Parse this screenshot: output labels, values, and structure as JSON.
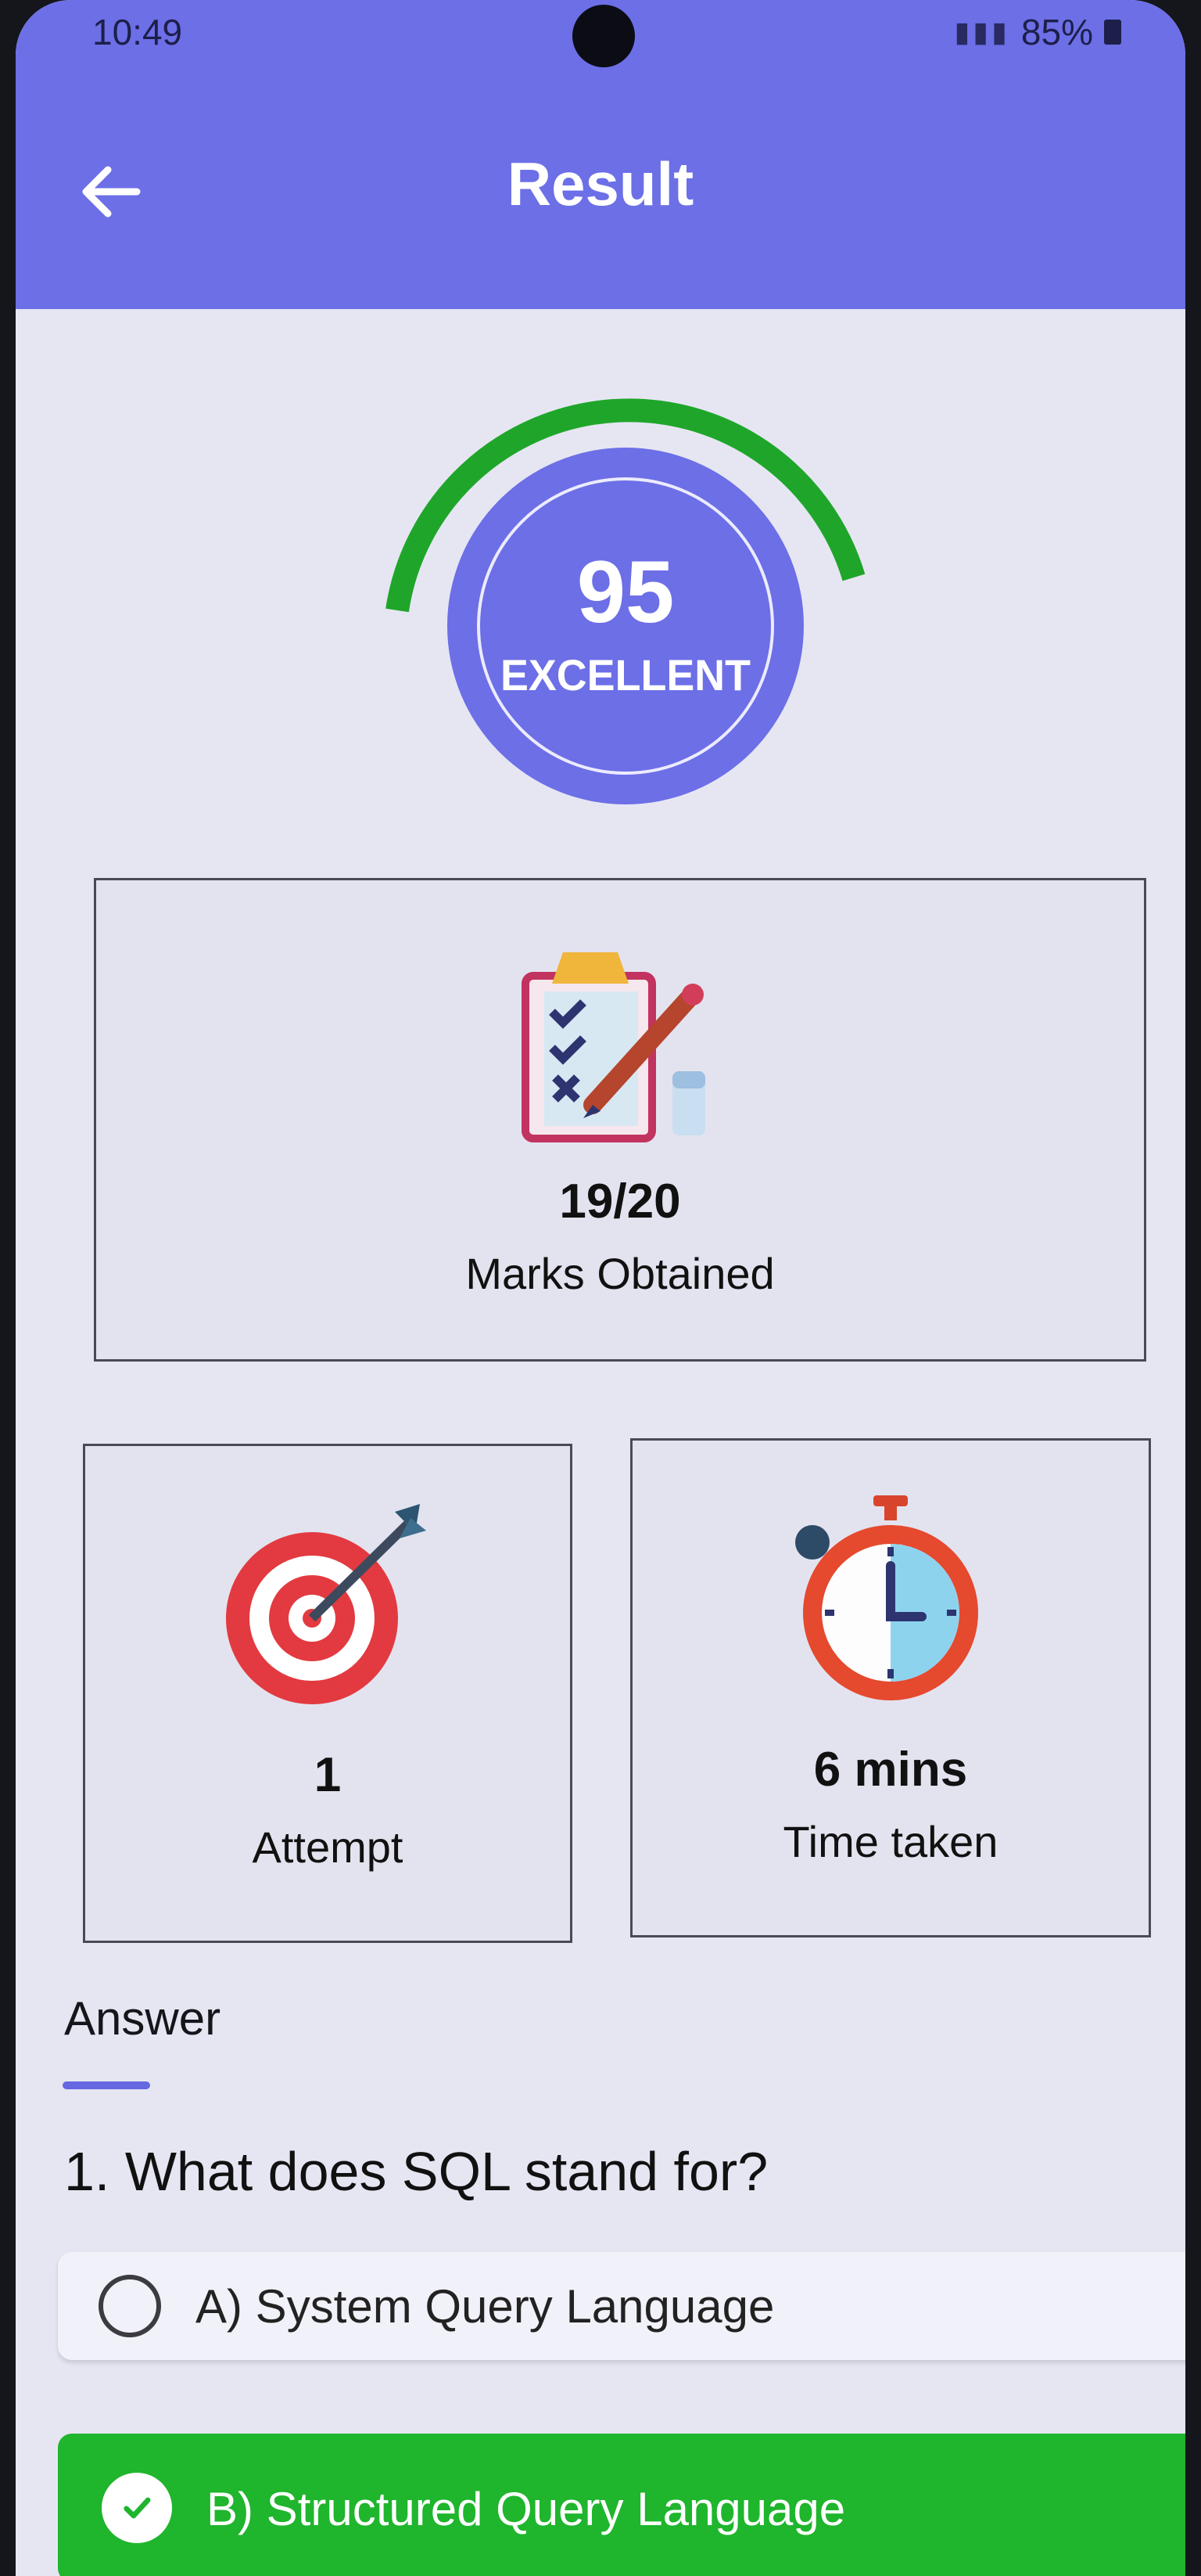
{
  "status_bar": {
    "time": "10:49",
    "battery": "85%"
  },
  "header": {
    "title": "Result"
  },
  "score": {
    "value": "95",
    "grade": "EXCELLENT",
    "progress_percent": 95
  },
  "marks_card": {
    "value": "19/20",
    "label": "Marks Obtained"
  },
  "attempt_card": {
    "value": "1",
    "label": "Attempt"
  },
  "time_card": {
    "value": "6 mins",
    "label": "Time taken"
  },
  "answers": {
    "heading": "Answer",
    "question": "1. What does SQL stand for?",
    "options": [
      {
        "label": "A) System Query Language",
        "selected": false
      },
      {
        "label": "B) Structured Query Language",
        "selected": true
      }
    ]
  },
  "colors": {
    "primary": "#6c6fe6",
    "gauge_arc": "#1fa62a",
    "correct": "#1fb52d",
    "background": "#e6e6f3"
  }
}
